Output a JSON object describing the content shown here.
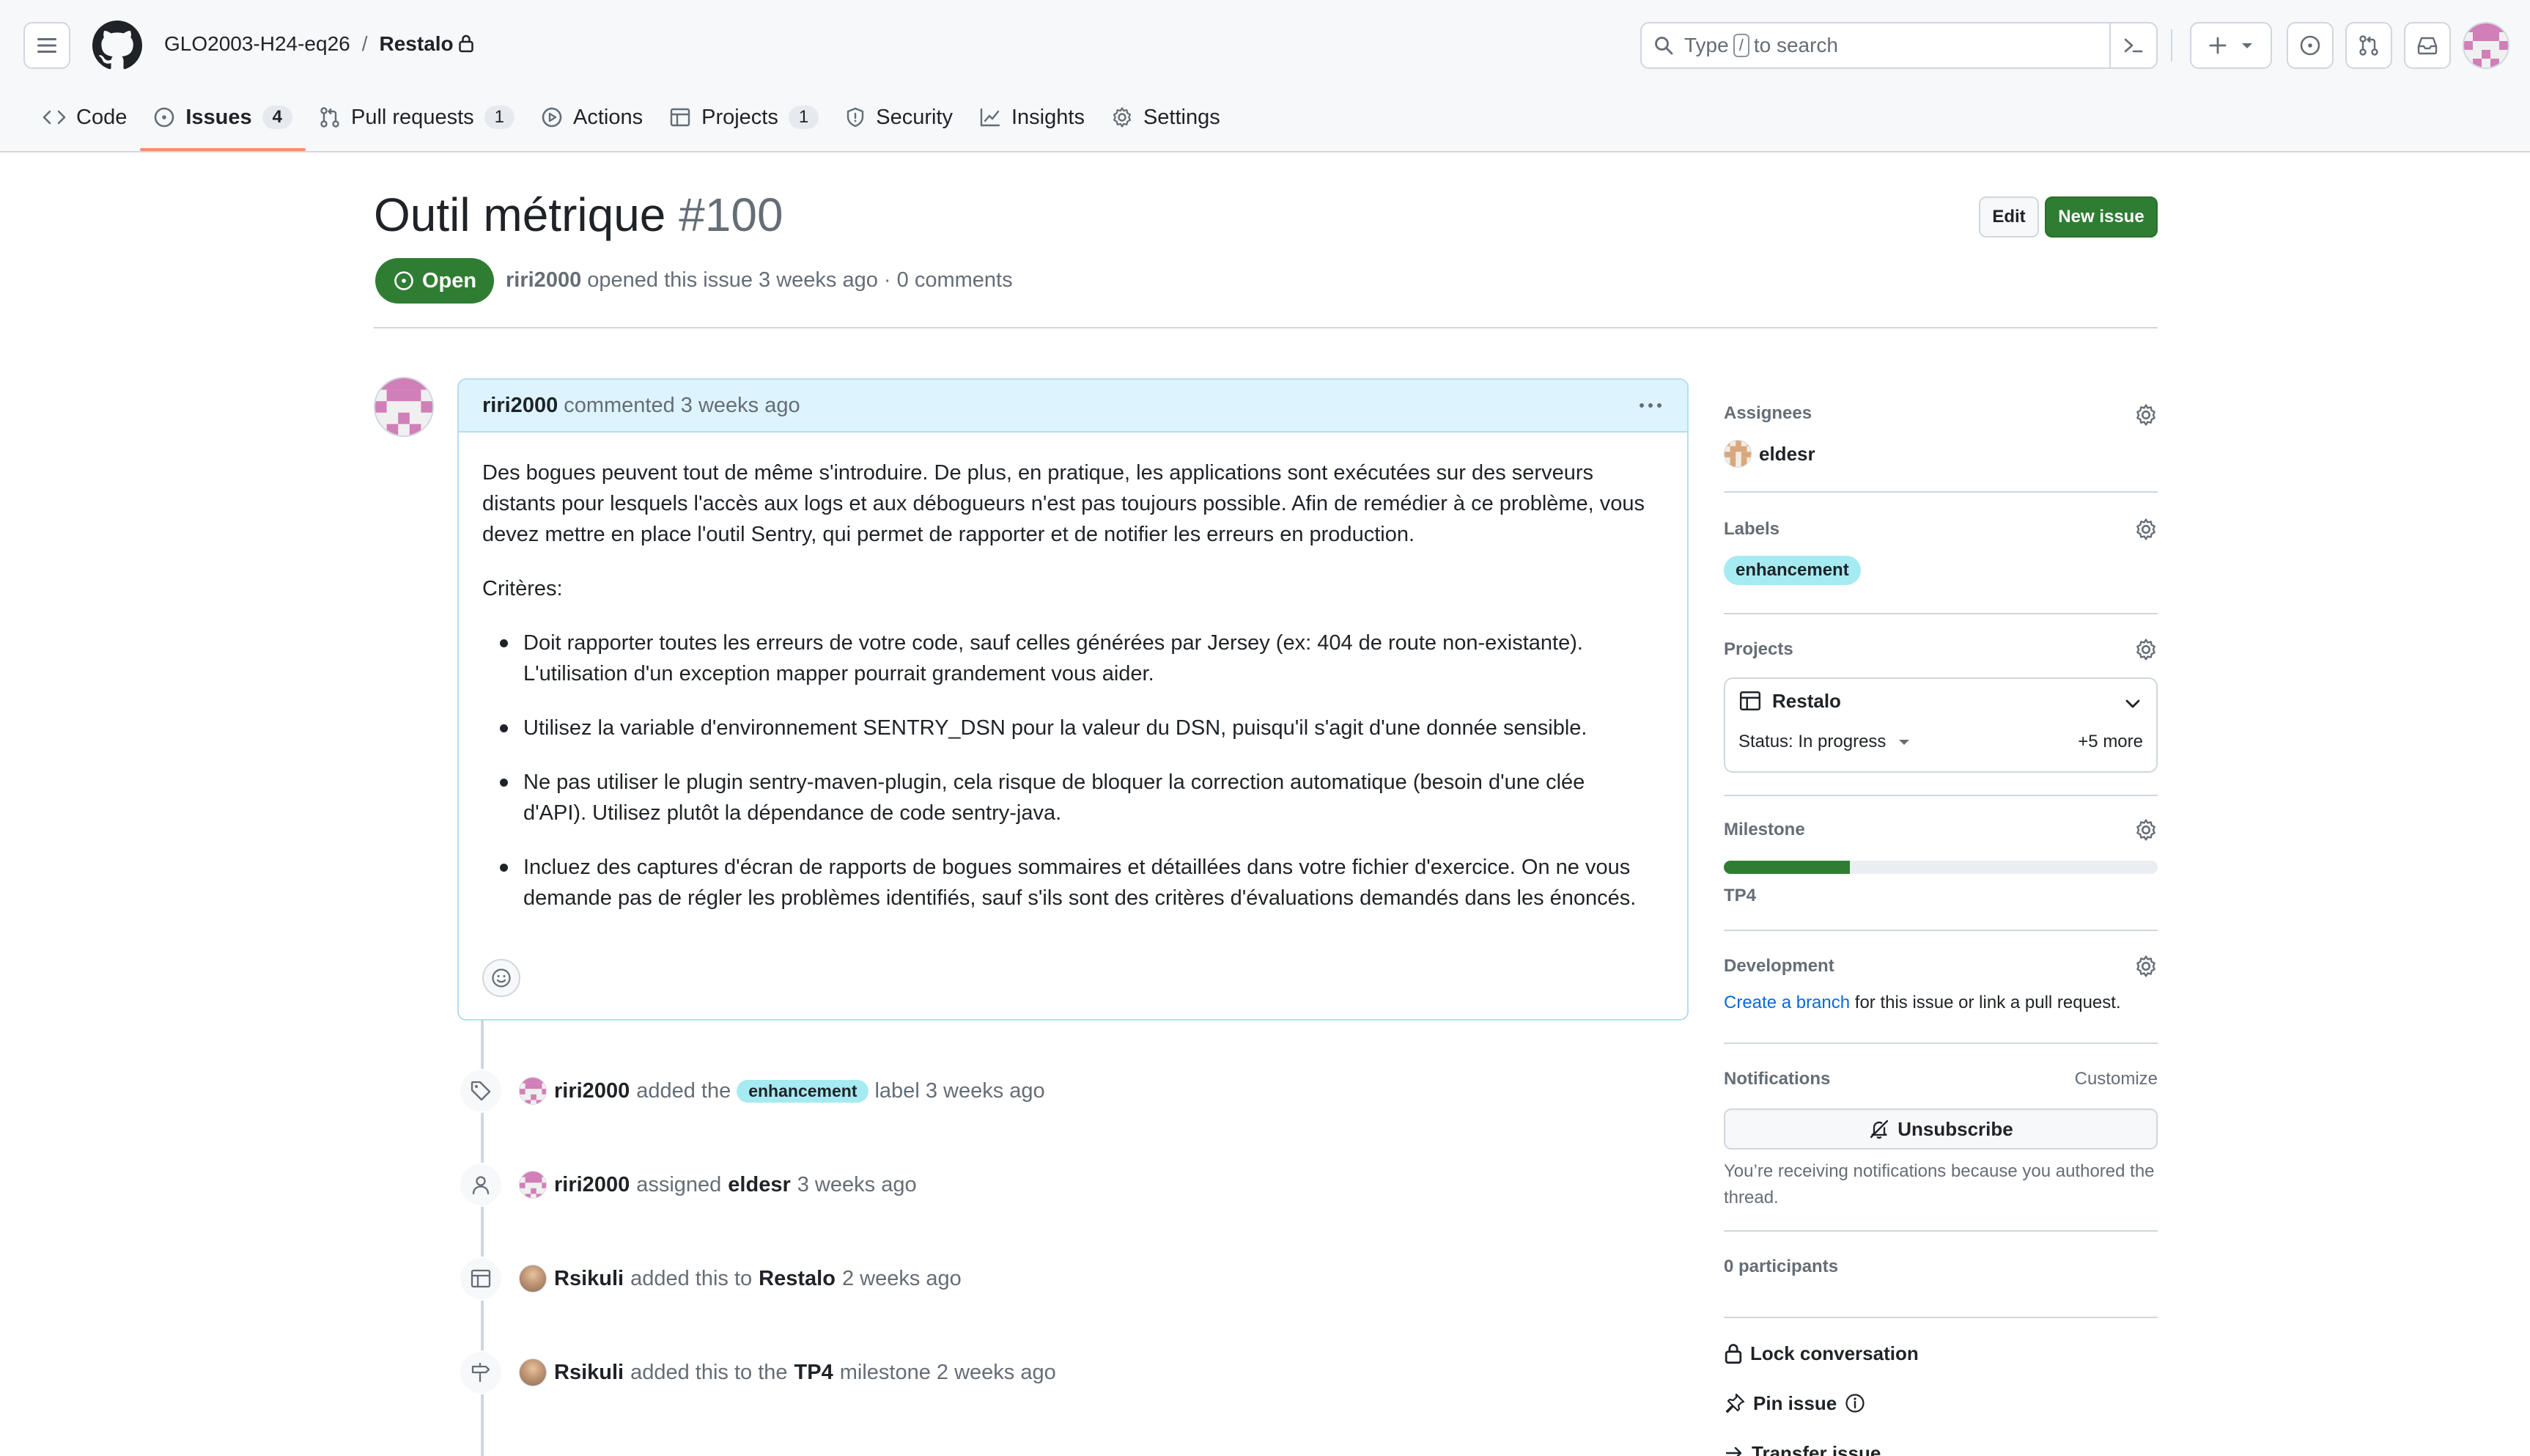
{
  "header": {
    "owner": "GLO2003-H24-eq26",
    "separator": "/",
    "repo": "Restalo",
    "search": {
      "prefix": "Type",
      "key": "/",
      "suffix": "to search"
    }
  },
  "tabs": [
    {
      "label": "Code",
      "count": null,
      "icon": "code-icon"
    },
    {
      "label": "Issues",
      "count": "4",
      "icon": "issue-opened-icon",
      "selected": true
    },
    {
      "label": "Pull requests",
      "count": "1",
      "icon": "git-pull-request-icon"
    },
    {
      "label": "Actions",
      "count": null,
      "icon": "play-icon"
    },
    {
      "label": "Projects",
      "count": "1",
      "icon": "table-icon"
    },
    {
      "label": "Security",
      "count": null,
      "icon": "shield-icon"
    },
    {
      "label": "Insights",
      "count": null,
      "icon": "graph-icon"
    },
    {
      "label": "Settings",
      "count": null,
      "icon": "gear-icon"
    }
  ],
  "issue": {
    "title": "Outil métrique",
    "number": "#100",
    "edit_label": "Edit",
    "new_issue_label": "New issue",
    "state": "Open",
    "author": "riri2000",
    "meta_text": "opened this issue 3 weeks ago · 0 comments"
  },
  "comment": {
    "author": "riri2000",
    "time": "commented 3 weeks ago",
    "paragraph1": "Des bogues peuvent tout de même s'introduire. De plus, en pratique, les applications sont exécutées sur des serveurs\ndistants pour lesquels l'accès aux logs et aux débogueurs n'est pas toujours possible. Afin de remédier à ce problème, vous\ndevez mettre en place l'outil Sentry, qui permet de rapporter et de notifier les erreurs en production.",
    "paragraph2": "Critères:",
    "bullets": [
      "Doit rapporter toutes les erreurs de votre code, sauf celles générées par Jersey (ex: 404 de route non-existante).\nL'utilisation d'un exception mapper pourrait grandement vous aider.",
      "Utilisez la variable d'environnement SENTRY_DSN pour la valeur du DSN, puisqu'il s'agit d'une donnée sensible.",
      "Ne pas utiliser le plugin sentry-maven-plugin, cela risque de bloquer la correction automatique (besoin d'une clée\nd'API). Utilisez plutôt la dépendance de code sentry-java.",
      "Incluez des captures d'écran de rapports de bogues sommaires et détaillées dans votre fichier d'exercice. On ne vous\ndemande pas de régler les problèmes identifiés, sauf s'ils sont des critères d'évaluations demandés dans les énoncés."
    ]
  },
  "events": [
    {
      "icon": "tag-icon",
      "actor": "riri2000",
      "t1": "added the",
      "label": "enhancement",
      "t2": "label 3 weeks ago"
    },
    {
      "icon": "person-icon",
      "actor": "riri2000",
      "t1": "assigned",
      "target": "eldesr",
      "t2": "3 weeks ago"
    },
    {
      "icon": "table-icon",
      "actor": "Rsikuli",
      "t1": "added this to",
      "target": "Restalo",
      "t2": "2 weeks ago"
    },
    {
      "icon": "milestone-icon",
      "actor": "Rsikuli",
      "t1": "added this to the",
      "target": "TP4",
      "t2": "milestone 2 weeks ago"
    }
  ],
  "sidebar": {
    "assignees_title": "Assignees",
    "assignee": "eldesr",
    "labels_title": "Labels",
    "label": "enhancement",
    "projects_title": "Projects",
    "project_name": "Restalo",
    "project_status": "Status: In progress",
    "project_more": "+5 more",
    "milestone_title": "Milestone",
    "milestone_progress": 0.29,
    "milestone_name": "TP4",
    "development_title": "Development",
    "dev_link": "Create a branch",
    "dev_text": "for this issue or link a pull request.",
    "notifications_title": "Notifications",
    "customize": "Customize",
    "unsubscribe": "Unsubscribe",
    "notif_note": "You’re receiving notifications because you authored the thread.",
    "participants": "0 participants",
    "lock": "Lock conversation",
    "pin": "Pin issue",
    "transfer": "Transfer issue"
  },
  "colors": {
    "open_green": "#2f7d32",
    "label_cyan": "#a6ebf1",
    "comment_header_blue": "#ddf4ff",
    "selected_tab_underline": "#fd8c73",
    "link_blue": "#0969da"
  }
}
